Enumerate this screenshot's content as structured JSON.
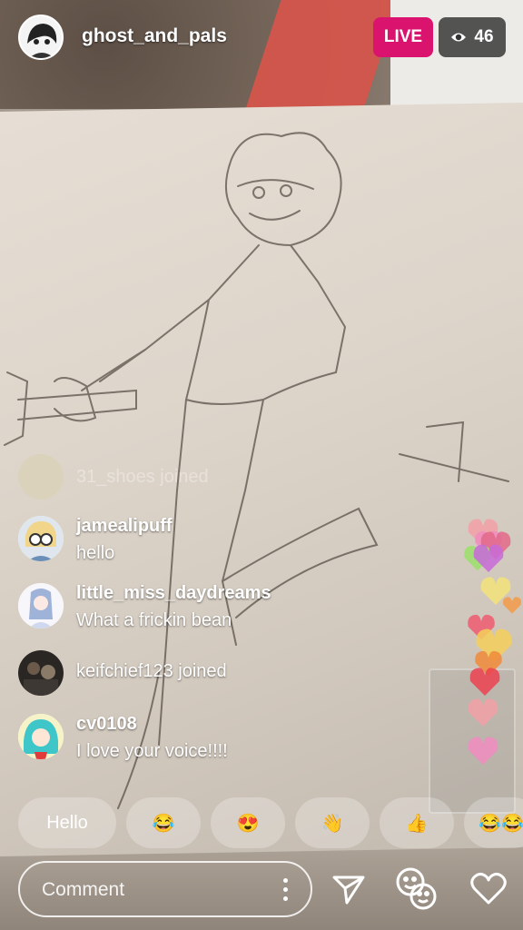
{
  "host": {
    "username": "ghost_and_pals"
  },
  "live_badge": "LIVE",
  "viewers": {
    "count": "46",
    "icon": "eye-icon"
  },
  "faded_comment": "31_shoes joined",
  "comments": [
    {
      "username": "jamealipuff",
      "text": "hello"
    },
    {
      "username": "little_miss_daydreams",
      "text": "What a frickin bean"
    },
    {
      "text": "keifchief123 joined"
    },
    {
      "username": "cv0108",
      "text": "I love your voice!!!!"
    }
  ],
  "quick_replies": [
    "Hello",
    "😂",
    "😍",
    "👋",
    "👍",
    "😂😂"
  ],
  "comment_input": {
    "placeholder": "Comment"
  },
  "actions": {
    "more": "more-icon",
    "send": "send-icon",
    "faces": "face-filter-icon",
    "like": "heart-icon"
  },
  "hearts_colors": [
    "#f2a0a6",
    "#f08cc0",
    "#e26a8a",
    "#9be06a",
    "#c86ad8",
    "#f3e27a",
    "#f39a4a",
    "#ee5a70",
    "#f5cf5a",
    "#f08a3a",
    "#ec4250"
  ]
}
